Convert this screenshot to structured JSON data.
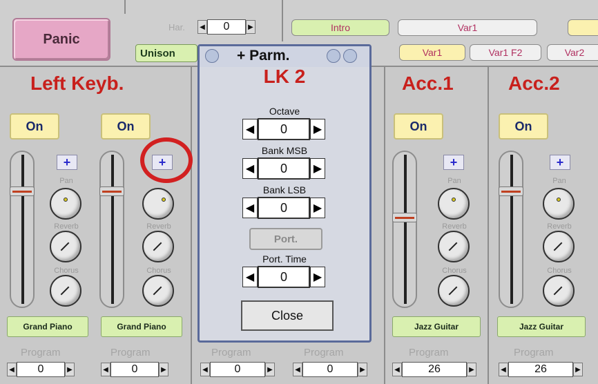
{
  "topbar": {
    "panic_label": "Panic",
    "har_label": "Har.",
    "har_value": "0",
    "unison_label": "Unison",
    "intro_label": "Intro",
    "var1_top_label": "Var1",
    "var1_label": "Var1",
    "var1_f2_label": "Var1 F2",
    "var2_label": "Var2"
  },
  "strips": {
    "left_keyb_title": "Left Keyb.",
    "acc1_title": "Acc.1",
    "acc2_title": "Acc.2",
    "on_label": "On",
    "plus_label": "+",
    "pan_label": "Pan",
    "reverb_label": "Reverb",
    "chorus_label": "Chorus",
    "program_label": "Program",
    "instruments": [
      "Grand Piano",
      "Grand Piano",
      "Jazz Guitar",
      "Jazz Guitar"
    ],
    "program_values": [
      "0",
      "0",
      "0",
      "0",
      "26",
      "26"
    ]
  },
  "dialog": {
    "title": "+ Parm.",
    "subtitle": "LK 2",
    "octave_label": "Octave",
    "octave_value": "0",
    "bank_msb_label": "Bank MSB",
    "bank_msb_value": "0",
    "bank_lsb_label": "Bank LSB",
    "bank_lsb_value": "0",
    "port_label": "Port.",
    "port_time_label": "Port. Time",
    "port_time_value": "0",
    "close_label": "Close"
  },
  "arrows": {
    "left": "◀",
    "right": "▶"
  },
  "colors": {
    "title_red": "#c8201c",
    "panic_pink": "#e6a7c6",
    "on_yellow": "#fbf1b0",
    "instrument_green": "#d9f0b0",
    "highlight_ring": "#d22020"
  }
}
